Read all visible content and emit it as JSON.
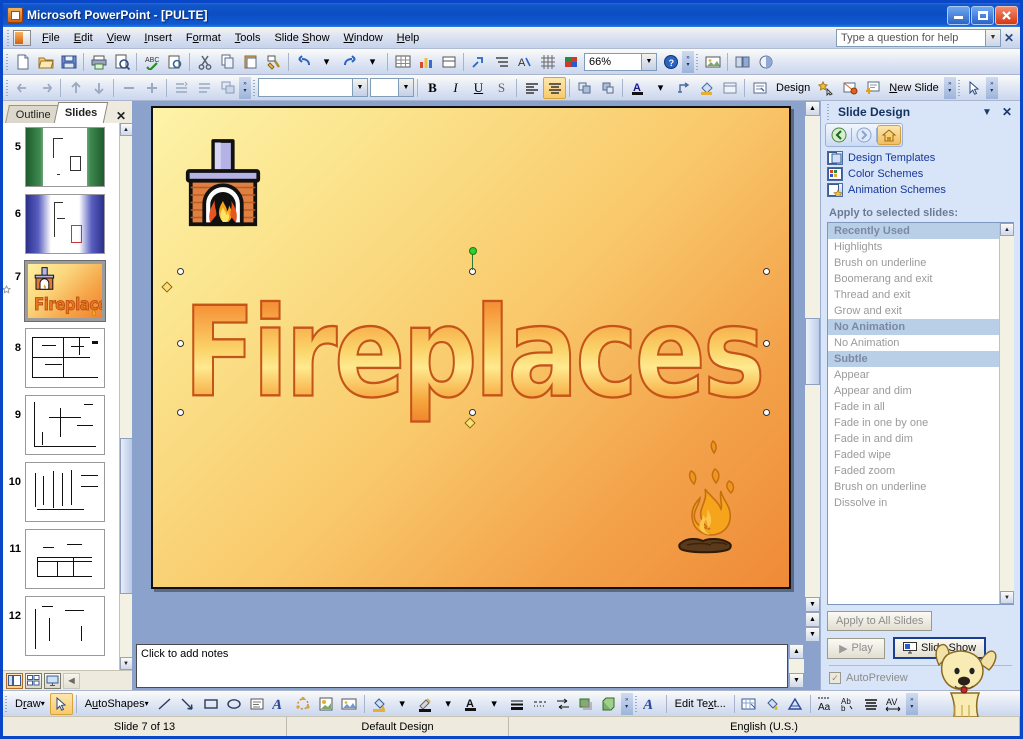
{
  "window": {
    "app_title": "Microsoft PowerPoint",
    "document_title": "[PULTE]",
    "title_separator": " - ",
    "minimize": "_",
    "maximize": "□",
    "close": "✕"
  },
  "menu": {
    "items": [
      {
        "label": "File",
        "accel": "F"
      },
      {
        "label": "Edit",
        "accel": "E"
      },
      {
        "label": "View",
        "accel": "V"
      },
      {
        "label": "Insert",
        "accel": "I"
      },
      {
        "label": "Format",
        "accel": "o"
      },
      {
        "label": "Tools",
        "accel": "T"
      },
      {
        "label": "Slide Show",
        "accel": "S"
      },
      {
        "label": "Window",
        "accel": "W"
      },
      {
        "label": "Help",
        "accel": "H"
      }
    ],
    "help_box_placeholder": "Type a question for help",
    "help_close": "✕"
  },
  "standard_toolbar": {
    "zoom_value": "66%",
    "buttons": [
      "new-icon",
      "open-icon",
      "save-icon",
      "print-icon",
      "print-preview-icon",
      "spelling-icon",
      "research-icon",
      "cut-icon",
      "copy-icon",
      "paste-icon",
      "format-painter-icon",
      "undo-icon",
      "redo-icon",
      "insert-chart-icon",
      "insert-table-icon",
      "tables-borders-icon",
      "insert-hyperlink-icon",
      "expand-all-icon",
      "show-formatting-icon",
      "grid-icon",
      "color-icon",
      "help-icon",
      "insert-picture-icon",
      "slide-layout-icon"
    ]
  },
  "formatting_toolbar": {
    "font_name": "",
    "font_size": "",
    "bold": "B",
    "italic": "I",
    "underline": "U",
    "shadow": "S",
    "design_label": "Design",
    "design_accel": "g",
    "new_slide_label": "New Slide",
    "new_slide_accel": "N"
  },
  "slides_pane": {
    "tabs": [
      {
        "label": "Outline",
        "active": false
      },
      {
        "label": "Slides",
        "active": true
      }
    ],
    "close": "✕",
    "thumbnails": [
      {
        "number": "5",
        "selected": false,
        "style": "green",
        "animated": false
      },
      {
        "number": "6",
        "selected": false,
        "style": "blue",
        "animated": false
      },
      {
        "number": "7",
        "selected": true,
        "style": "fireplaces",
        "animated": true,
        "title": "Fireplaces"
      },
      {
        "number": "8",
        "selected": false,
        "style": "blueprint",
        "animated": false
      },
      {
        "number": "9",
        "selected": false,
        "style": "blueprint",
        "animated": false
      },
      {
        "number": "10",
        "selected": false,
        "style": "blueprint",
        "animated": false
      },
      {
        "number": "11",
        "selected": false,
        "style": "blueprint",
        "animated": false
      },
      {
        "number": "12",
        "selected": false,
        "style": "blueprint",
        "animated": false
      }
    ]
  },
  "slide": {
    "wordart_text": "Fireplaces",
    "clipart": [
      "fireplace-clipart",
      "campfire-clipart"
    ]
  },
  "notes": {
    "placeholder": "Click to add notes"
  },
  "task_pane": {
    "title": "Slide Design",
    "close": "✕",
    "menu_arrow": "▼",
    "nav": [
      "back-arrow-icon",
      "forward-arrow-icon",
      "home-icon"
    ],
    "links": [
      {
        "label": "Design Templates",
        "icon": "design-templates-icon"
      },
      {
        "label": "Color Schemes",
        "icon": "color-schemes-icon"
      },
      {
        "label": "Animation Schemes",
        "icon": "animation-schemes-icon"
      }
    ],
    "apply_label": "Apply to selected slides:",
    "scheme_list": [
      {
        "label": "Recently Used",
        "type": "group"
      },
      {
        "label": "Highlights",
        "type": "item"
      },
      {
        "label": "Brush on underline",
        "type": "item"
      },
      {
        "label": "Boomerang and exit",
        "type": "item"
      },
      {
        "label": "Thread and exit",
        "type": "item"
      },
      {
        "label": "Grow and exit",
        "type": "item"
      },
      {
        "label": "No Animation",
        "type": "group"
      },
      {
        "label": "No Animation",
        "type": "item"
      },
      {
        "label": "Subtle",
        "type": "group"
      },
      {
        "label": "Appear",
        "type": "item"
      },
      {
        "label": "Appear and dim",
        "type": "item"
      },
      {
        "label": "Fade in all",
        "type": "item"
      },
      {
        "label": "Fade in one by one",
        "type": "item"
      },
      {
        "label": "Fade in and dim",
        "type": "item"
      },
      {
        "label": "Faded wipe",
        "type": "item"
      },
      {
        "label": "Faded zoom",
        "type": "item"
      },
      {
        "label": "Brush on underline",
        "type": "item"
      },
      {
        "label": "Dissolve in",
        "type": "item"
      }
    ],
    "apply_all_label": "Apply to All Slides",
    "play_label": "Play",
    "slide_show_label": "Slide Show",
    "autopreview_label": "AutoPreview",
    "autopreview_checked": true
  },
  "drawing_toolbar": {
    "draw_label": "Draw",
    "draw_accel": "r",
    "autoshapes_label": "AutoShapes",
    "autoshapes_accel": "u",
    "edit_text_label": "Edit Text..."
  },
  "status_bar": {
    "slide_counter": "Slide 7 of 13",
    "design_name": "Default Design",
    "language": "English (U.S.)"
  },
  "view_buttons": [
    "normal-view-icon",
    "slide-sorter-icon",
    "slide-show-icon"
  ],
  "colors": {
    "title_blue": "#0b4ec4",
    "task_pane_bg": "#d8e4f8",
    "link_blue": "#14389c",
    "group_header": "#b9cfe8",
    "slide_gradient_start": "#fdf3a8",
    "slide_gradient_end": "#ef8a37",
    "wordart_stroke": "#c4541a"
  }
}
